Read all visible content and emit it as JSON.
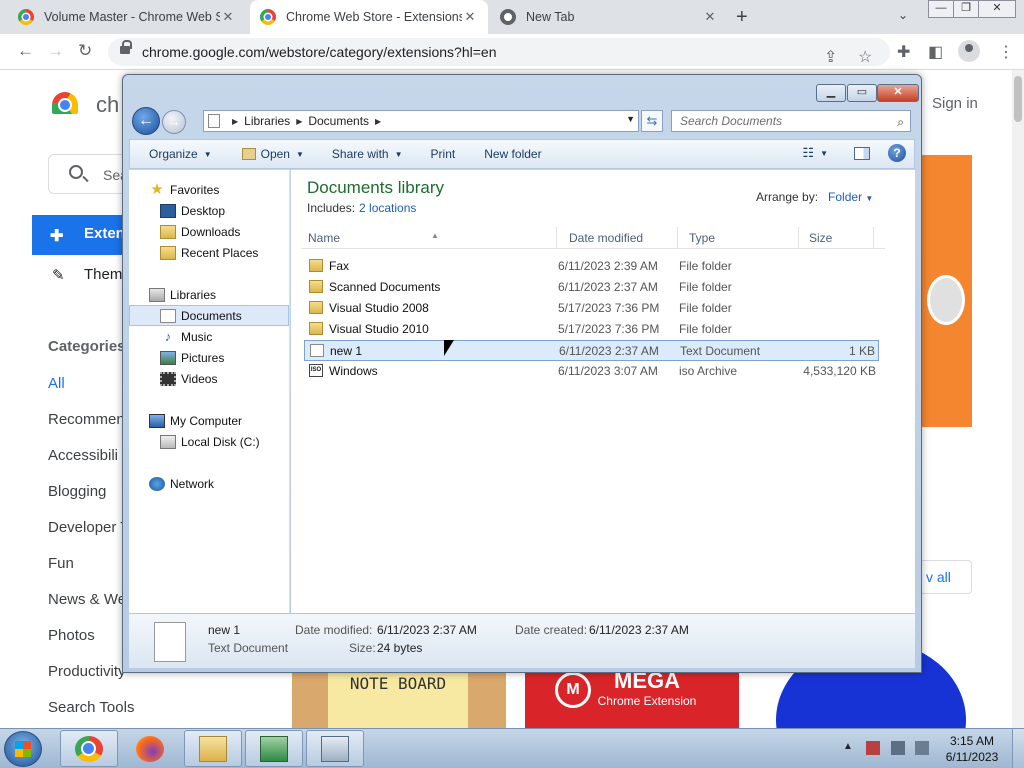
{
  "browser": {
    "tabs": [
      {
        "title": "Volume Master - Chrome Web St",
        "close": "✕"
      },
      {
        "title": "Chrome Web Store - Extensions",
        "close": "✕"
      },
      {
        "title": "New Tab",
        "close": "✕"
      }
    ],
    "new_tab": "+",
    "tab_list": "⌄",
    "window_controls": {
      "minimize": "—",
      "maximize": "❐",
      "close": "✕"
    },
    "url": "chrome.google.com/webstore/category/extensions?hl=en"
  },
  "webstore": {
    "brand": "ch",
    "signin": "Sign in",
    "search_placeholder": "Sea",
    "nav": {
      "extensions": "Exten",
      "themes": "Them"
    },
    "categories_heading": "Categories",
    "categories": [
      "All",
      "Recommen",
      "Accessibili",
      "Blogging",
      "Developer T",
      "Fun",
      "News & We",
      "Photos",
      "Productivity",
      "Search Tools"
    ],
    "view_all": "v all",
    "tiles": {
      "note_board": "NOTE BOARD",
      "mega": "MEGA",
      "mega_sub": "Chrome Extension"
    }
  },
  "explorer": {
    "controls": {
      "minimize": "▁",
      "maximize": "▭",
      "close": "✕"
    },
    "breadcrumb": [
      "Libraries",
      "Documents"
    ],
    "search_placeholder": "Search Documents",
    "commands": [
      "Organize",
      "Open",
      "Share with",
      "Print",
      "New folder"
    ],
    "nav": {
      "favorites": {
        "label": "Favorites",
        "items": [
          "Desktop",
          "Downloads",
          "Recent Places"
        ]
      },
      "libraries": {
        "label": "Libraries",
        "items": [
          "Documents",
          "Music",
          "Pictures",
          "Videos"
        ]
      },
      "computer": {
        "label": "My Computer",
        "items": [
          "Local Disk (C:)"
        ]
      },
      "network": "Network"
    },
    "library_title": "Documents library",
    "includes_label": "Includes:",
    "includes_link": "2 locations",
    "arrange_label": "Arrange by:",
    "arrange_value": "Folder",
    "columns": [
      "Name",
      "Date modified",
      "Type",
      "Size"
    ],
    "files": [
      {
        "name": "Fax",
        "date": "6/11/2023 2:39 AM",
        "type": "File folder",
        "size": "",
        "icon": "folder-icon"
      },
      {
        "name": "Scanned Documents",
        "date": "6/11/2023 2:37 AM",
        "type": "File folder",
        "size": "",
        "icon": "folder-icon"
      },
      {
        "name": "Visual Studio 2008",
        "date": "5/17/2023 7:36 PM",
        "type": "File folder",
        "size": "",
        "icon": "folder-icon"
      },
      {
        "name": "Visual Studio 2010",
        "date": "5/17/2023 7:36 PM",
        "type": "File folder",
        "size": "",
        "icon": "folder-icon"
      },
      {
        "name": "new 1",
        "date": "6/11/2023 2:37 AM",
        "type": "Text Document",
        "size": "1 KB",
        "icon": "text-file-icon"
      },
      {
        "name": "Windows",
        "date": "6/11/2023 3:07 AM",
        "type": "iso Archive",
        "size": "4,533,120 KB",
        "icon": "iso-file-icon"
      }
    ],
    "details": {
      "name": "new 1",
      "type": "Text Document",
      "date_modified_label": "Date modified:",
      "date_modified": "6/11/2023 2:37 AM",
      "date_created_label": "Date created:",
      "date_created": "6/11/2023 2:37 AM",
      "size_label": "Size:",
      "size": "24 bytes"
    }
  },
  "taskbar": {
    "clock_time": "3:15 AM",
    "clock_date": "6/11/2023",
    "tray_arrow": "▲"
  }
}
